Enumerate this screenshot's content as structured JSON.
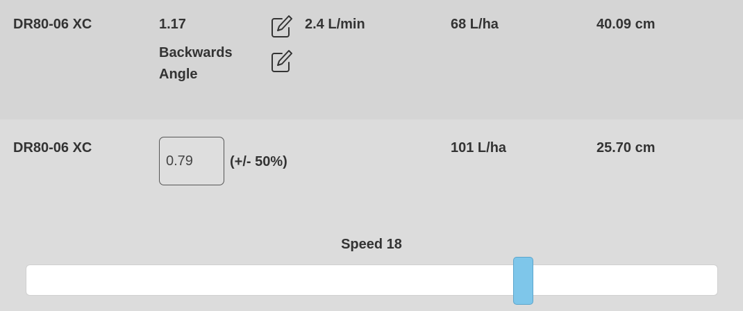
{
  "rows": [
    {
      "model": "DR80-06 XC",
      "value": "1.17",
      "mode": "Backwards Angle",
      "flow": "2.4 L/min",
      "rate": "68 L/ha",
      "spacing": "40.09 cm"
    },
    {
      "model": "DR80-06 XC",
      "input_value": "0.79",
      "tolerance": "(+/- 50%)",
      "rate": "101 L/ha",
      "spacing": "25.70 cm"
    }
  ],
  "speed": {
    "label": "Speed 18",
    "value": 18,
    "slider_fraction": 0.71
  },
  "colors": {
    "slider_thumb": "#7ec6ea",
    "row_bg": "#d5d5d5",
    "page_bg": "#dcdcdc"
  }
}
